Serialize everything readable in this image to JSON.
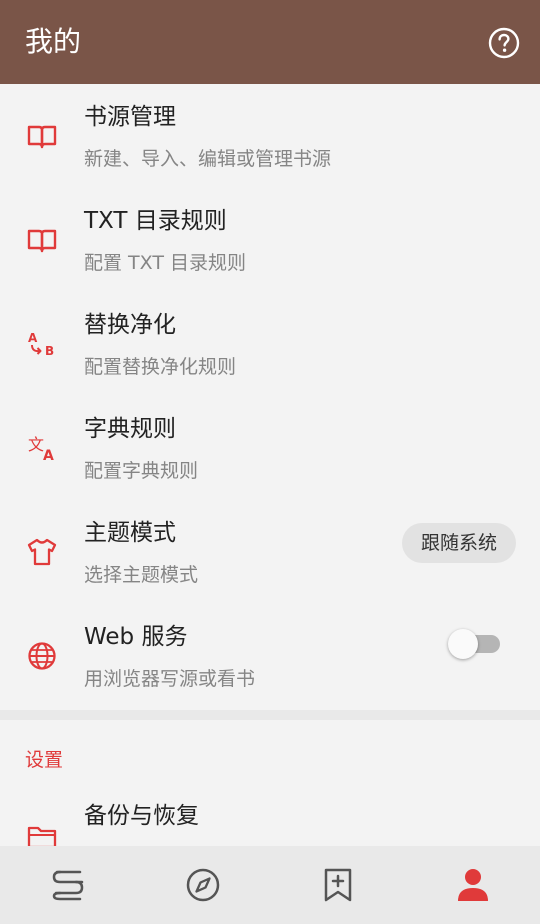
{
  "appbar": {
    "title": "我的",
    "help_icon": "help-circle-icon"
  },
  "menu": [
    {
      "title": "书源管理",
      "subtitle": "新建、导入、编辑或管理书源",
      "icon": "book-open-icon"
    },
    {
      "title": "TXT 目录规则",
      "subtitle": "配置 TXT 目录规则",
      "icon": "book-open-icon"
    },
    {
      "title": "替换净化",
      "subtitle": "配置替换净化规则",
      "icon": "replace-ab-icon"
    },
    {
      "title": "字典规则",
      "subtitle": "配置字典规则",
      "icon": "translate-icon"
    },
    {
      "title": "主题模式",
      "subtitle": "选择主题模式",
      "icon": "shirt-icon",
      "value": "跟随系统"
    },
    {
      "title": "Web 服务",
      "subtitle": "用浏览器写源或看书",
      "icon": "globe-icon",
      "toggle": false
    }
  ],
  "settings": {
    "section_title": "设置",
    "items": [
      {
        "title": "备份与恢复",
        "icon": "folder-icon"
      }
    ]
  },
  "bottom_nav": [
    {
      "icon": "bookshelf-icon",
      "active": false
    },
    {
      "icon": "compass-icon",
      "active": false
    },
    {
      "icon": "bookmark-add-icon",
      "active": false
    },
    {
      "icon": "person-icon",
      "active": true
    }
  ],
  "colors": {
    "appbar": "#7a5548",
    "accent": "#e03a3a",
    "icon_inactive": "#555555"
  }
}
